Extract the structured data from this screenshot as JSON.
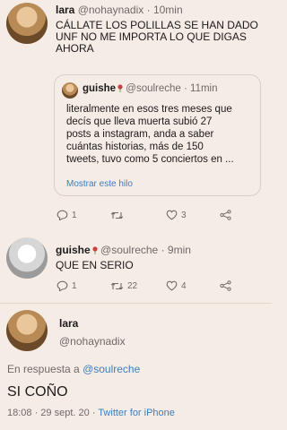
{
  "tweet1": {
    "name": "lara",
    "handle": "@nohaynadix",
    "time": "· 10min",
    "text": [
      "CÁLLATE LOS POLILLAS SE HAN DADO",
      "UNF NO ME IMPORTA LO QUE DIGAS",
      "AHORA"
    ],
    "quoted": {
      "name": "guishe",
      "handle": "@soulreche",
      "time": "· 11min",
      "text": [
        "literalmente en esos tres meses que",
        "decís que lleva muerta subió 27",
        "posts a instagram, anda a saber",
        "cuántas historias, más de 150",
        "tweets, tuvo como 5 conciertos en ..."
      ],
      "show_thread": "Mostrar este hilo"
    },
    "replies": "1",
    "retweets": "",
    "likes": "3"
  },
  "tweet2": {
    "name": "guishe",
    "handle": "@soulreche",
    "time": "· 9min",
    "text": "QUE EN SERIO",
    "replies": "1",
    "retweets": "22",
    "likes": "4"
  },
  "tweet3": {
    "name": "lara",
    "handle": "@nohaynadix",
    "reply_prefix": "En respuesta a",
    "reply_to": "@soulreche",
    "text": "SI COÑO",
    "timestamp": "18:08 · 29 sept. 20 ·",
    "source": "Twitter for iPhone"
  },
  "colors": {
    "accent": "#3a7ec0",
    "background": "#f6ece6",
    "muted": "#6e6a68"
  },
  "icons": [
    "reply-icon",
    "retweet-icon",
    "like-icon",
    "share-icon",
    "rose-icon"
  ]
}
